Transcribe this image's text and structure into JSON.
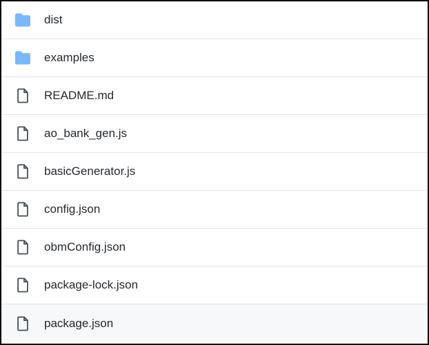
{
  "files": [
    {
      "name": "dist",
      "type": "folder"
    },
    {
      "name": "examples",
      "type": "folder"
    },
    {
      "name": "README.md",
      "type": "file"
    },
    {
      "name": "ao_bank_gen.js",
      "type": "file"
    },
    {
      "name": "basicGenerator.js",
      "type": "file"
    },
    {
      "name": "config.json",
      "type": "file"
    },
    {
      "name": "obmConfig.json",
      "type": "file"
    },
    {
      "name": "package-lock.json",
      "type": "file"
    },
    {
      "name": "package.json",
      "type": "file"
    }
  ],
  "colors": {
    "folder": "#79b8ff",
    "file_stroke": "#444d56"
  }
}
